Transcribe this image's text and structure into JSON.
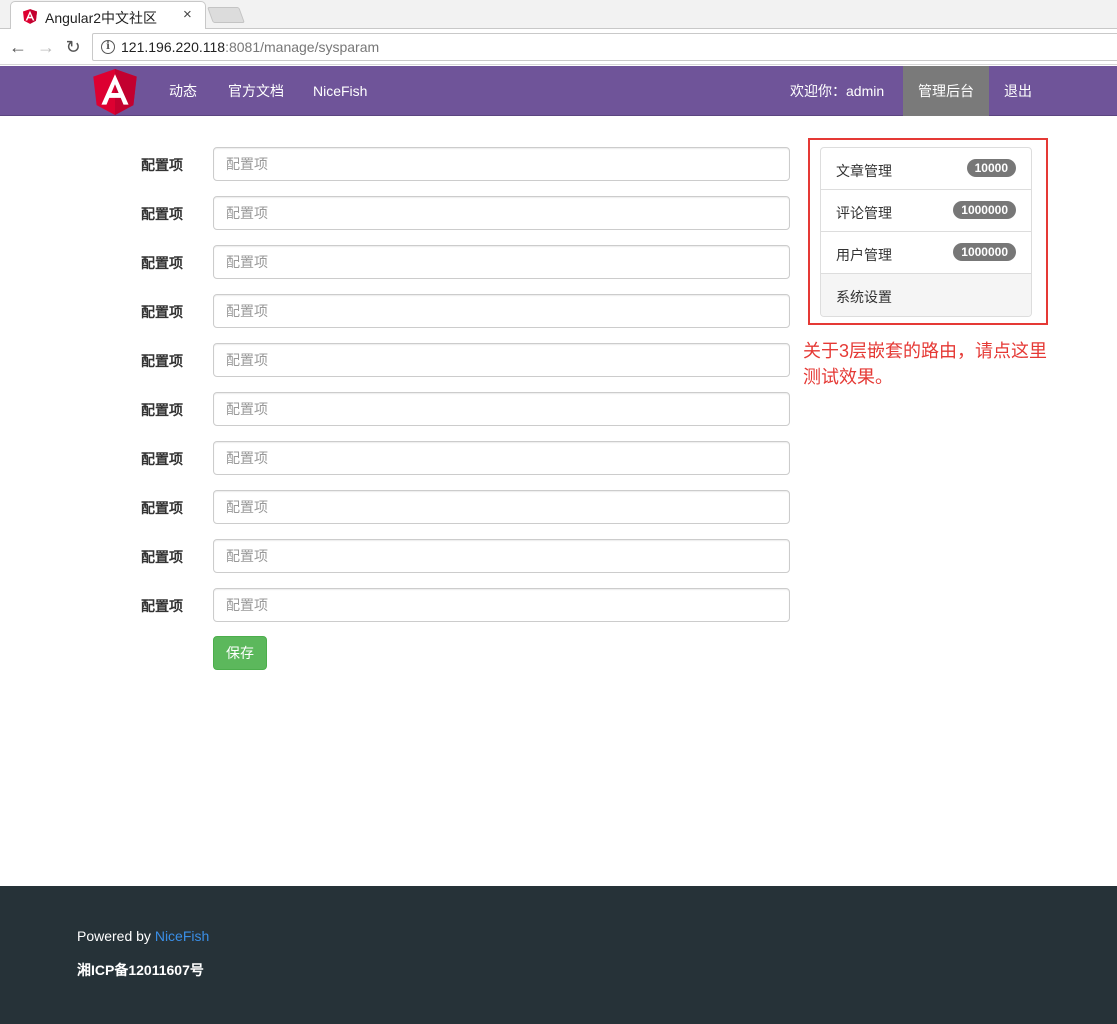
{
  "browser": {
    "tab_title": "Angular2中文社区",
    "tab_close": "×",
    "url_host": "121.196.220.118",
    "url_rest": ":8081/manage/sysparam",
    "back_icon": "←",
    "forward_icon": "→",
    "reload_icon": "↻",
    "info_icon": "i"
  },
  "navbar": {
    "links": [
      "动态",
      "官方文档",
      "NiceFish"
    ],
    "welcome": "欢迎你：admin",
    "admin": "管理后台",
    "logout": "退出",
    "brand_color": "#6f5499",
    "logo_color": "#dd0031"
  },
  "form": {
    "rows": [
      {
        "label": "配置项",
        "placeholder": "配置项"
      },
      {
        "label": "配置项",
        "placeholder": "配置项"
      },
      {
        "label": "配置项",
        "placeholder": "配置项"
      },
      {
        "label": "配置项",
        "placeholder": "配置项"
      },
      {
        "label": "配置项",
        "placeholder": "配置项"
      },
      {
        "label": "配置项",
        "placeholder": "配置项"
      },
      {
        "label": "配置项",
        "placeholder": "配置项"
      },
      {
        "label": "配置项",
        "placeholder": "配置项"
      },
      {
        "label": "配置项",
        "placeholder": "配置项"
      },
      {
        "label": "配置项",
        "placeholder": "配置项"
      }
    ],
    "save_label": "保存"
  },
  "side_menu": {
    "items": [
      {
        "label": "文章管理",
        "badge": "10000"
      },
      {
        "label": "评论管理",
        "badge": "1000000"
      },
      {
        "label": "用户管理",
        "badge": "1000000"
      },
      {
        "label": "系统设置",
        "badge": ""
      }
    ],
    "annotation_line1": "关于3层嵌套的路由，请点这里",
    "annotation_line2": "测试效果。"
  },
  "footer": {
    "powered_prefix": "Powered by ",
    "powered_link": "NiceFish",
    "icp": "湘ICP备12011607号"
  }
}
